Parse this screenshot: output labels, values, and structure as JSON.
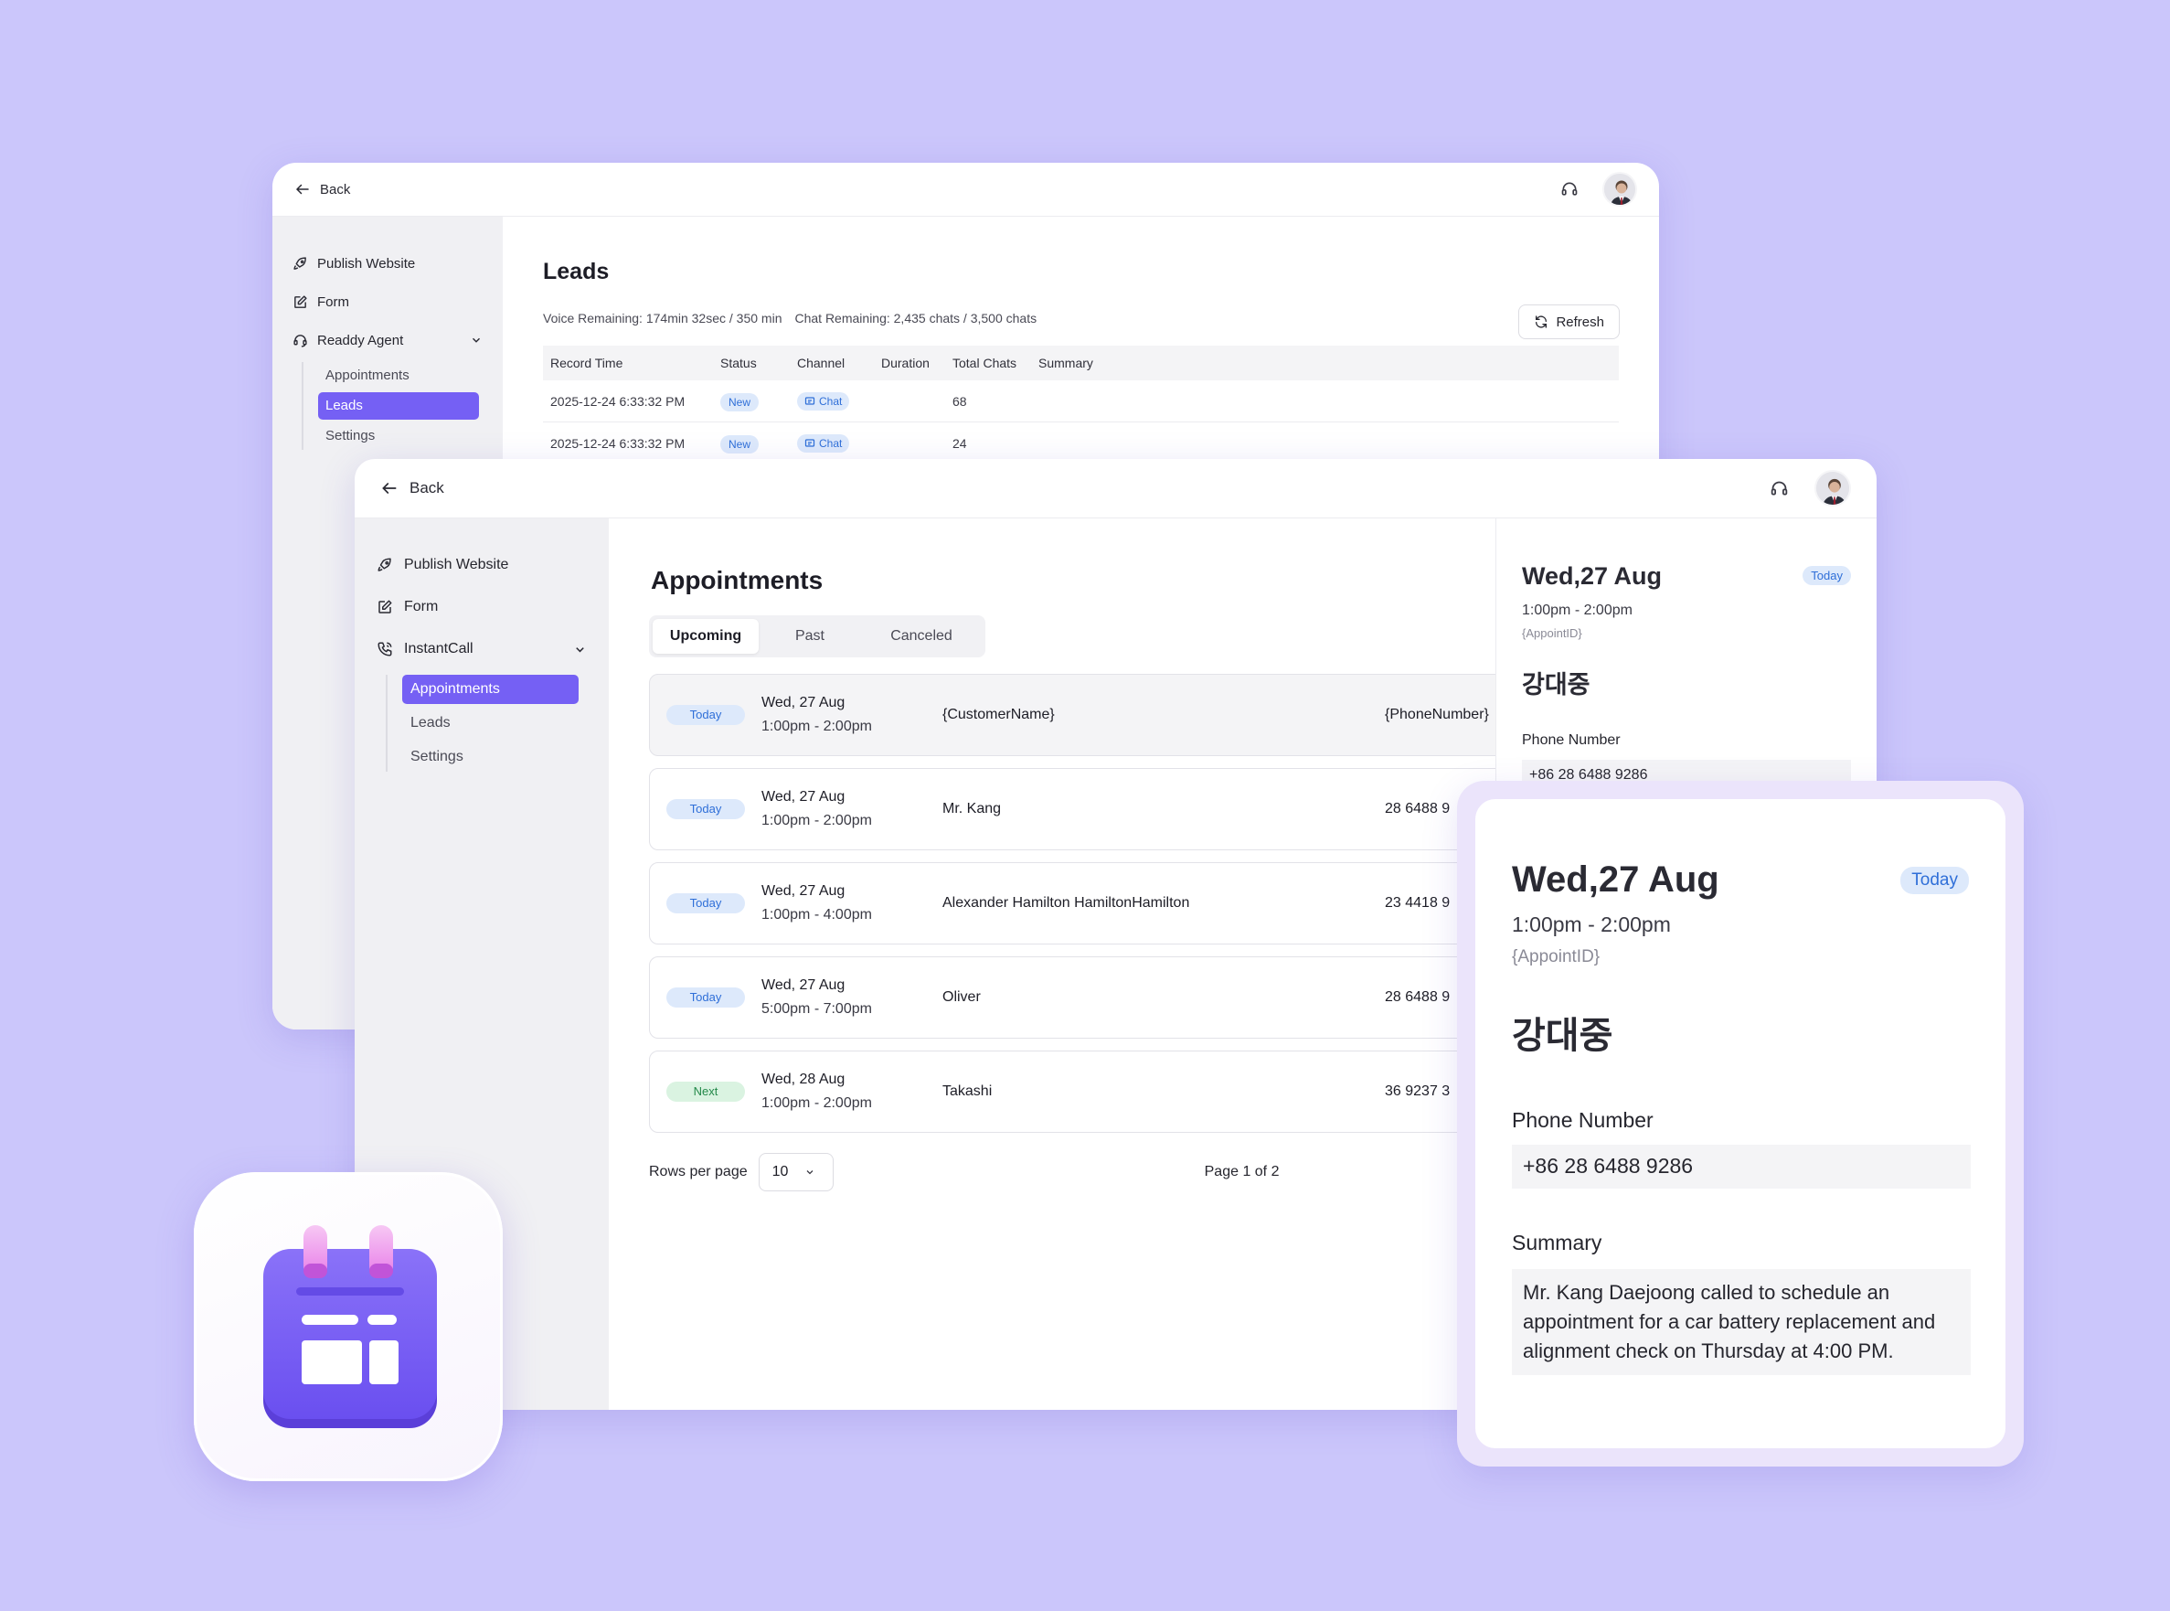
{
  "leads_window": {
    "back_label": "Back",
    "sidebar": {
      "publish": "Publish Website",
      "form": "Form",
      "agent": "Readdy Agent",
      "sub": [
        "Appointments",
        "Leads",
        "Settings"
      ]
    },
    "title": "Leads",
    "voice_remaining": "Voice Remaining: 174min 32sec / 350 min",
    "chat_remaining": "Chat Remaining: 2,435 chats / 3,500 chats",
    "refresh_label": "Refresh",
    "columns": [
      "Record Time",
      "Status",
      "Channel",
      "Duration",
      "Total Chats",
      "Summary"
    ],
    "rows": [
      {
        "time": "2025-12-24 6:33:32 PM",
        "status": "New",
        "channel": "Chat",
        "duration": "",
        "total": "68",
        "summary": ""
      },
      {
        "time": "2025-12-24 6:33:32 PM",
        "status": "New",
        "channel": "Chat",
        "duration": "",
        "total": "24",
        "summary": ""
      }
    ]
  },
  "appt_window": {
    "back_label": "Back",
    "sidebar": {
      "publish": "Publish Website",
      "form": "Form",
      "instantcall": "InstantCall",
      "sub": [
        "Appointments",
        "Leads",
        "Settings"
      ]
    },
    "title": "Appointments",
    "tabs": [
      "Upcoming",
      "Past",
      "Canceled"
    ],
    "rows": [
      {
        "badge": "Today",
        "date": "Wed, 27 Aug",
        "time": "1:00pm - 2:00pm",
        "name": "{CustomerName}",
        "phone": "{PhoneNumber}"
      },
      {
        "badge": "Today",
        "date": "Wed, 27 Aug",
        "time": "1:00pm - 2:00pm",
        "name": "Mr. Kang",
        "phone": "28 6488 9"
      },
      {
        "badge": "Today",
        "date": "Wed, 27 Aug",
        "time": "1:00pm - 4:00pm",
        "name": "Alexander Hamilton HamiltonHamilton",
        "phone": "23 4418 9"
      },
      {
        "badge": "Today",
        "date": "Wed, 27 Aug",
        "time": "5:00pm - 7:00pm",
        "name": "Oliver",
        "phone": "28 6488 9"
      },
      {
        "badge": "Next",
        "date": "Wed, 28 Aug",
        "time": "1:00pm - 2:00pm",
        "name": "Takashi",
        "phone": "36 9237 3"
      }
    ],
    "rows_per_page_label": "Rows per page",
    "rows_per_page_value": "10",
    "page_info": "Page 1 of 2"
  },
  "detail": {
    "date": "Wed,27 Aug",
    "badge": "Today",
    "time": "1:00pm - 2:00pm",
    "appoint_id": "{AppointID}",
    "name": "강대중",
    "phone_label": "Phone Number",
    "phone": "+86 28 6488 9286",
    "summary_label": "Summary",
    "summary": "Mr. Kang Daejoong called to schedule an appointment for a car battery replacement and alignment check on Thursday at 4:00 PM."
  },
  "colors": {
    "background": "#cbc6fb",
    "accent": "#7560f4",
    "badge_today_bg": "#dde9fb",
    "badge_next_bg": "#daf3e1"
  },
  "icons": [
    "arrow-left-icon",
    "headset-icon",
    "rocket-icon",
    "edit-icon",
    "agent-icon",
    "phone-icon",
    "chevron-down-icon",
    "refresh-icon",
    "chat-icon",
    "calendar-app-icon"
  ]
}
